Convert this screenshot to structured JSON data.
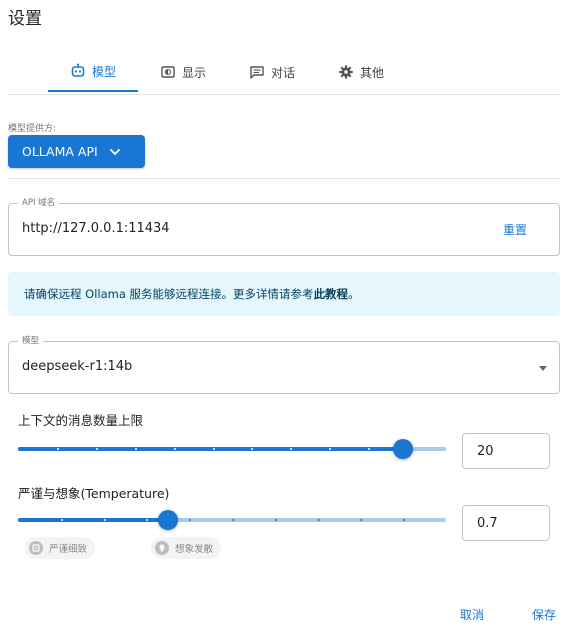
{
  "title": "设置",
  "tabs": [
    {
      "label": "模型",
      "icon": "robot-icon",
      "active": true
    },
    {
      "label": "显示",
      "icon": "display-icon",
      "active": false
    },
    {
      "label": "对话",
      "icon": "chat-icon",
      "active": false
    },
    {
      "label": "其他",
      "icon": "gear-icon",
      "active": false
    }
  ],
  "provider": {
    "label": "模型提供方:",
    "selected": "OLLAMA API"
  },
  "api_host": {
    "legend": "API 域名",
    "value": "http://127.0.0.1:11434",
    "reset_label": "重置"
  },
  "alert": {
    "text": "请确保远程 Ollama 服务能够远程连接。更多详情请参考",
    "link": "此教程",
    "suffix": "。"
  },
  "model": {
    "legend": "模型",
    "selected": "deepseek-r1:14b"
  },
  "context_limit": {
    "label": "上下文的消息数量上限",
    "value": "20",
    "fraction": 0.9
  },
  "temperature": {
    "label": "严谨与想象(Temperature)",
    "value": "0.7",
    "fraction": 0.35
  },
  "chips": {
    "strict": "严谨细致",
    "imaginative": "想象发散"
  },
  "footer": {
    "cancel": "取消",
    "save": "保存"
  },
  "colors": {
    "accent": "#1976d2",
    "alert_bg": "#e5f6fd"
  }
}
